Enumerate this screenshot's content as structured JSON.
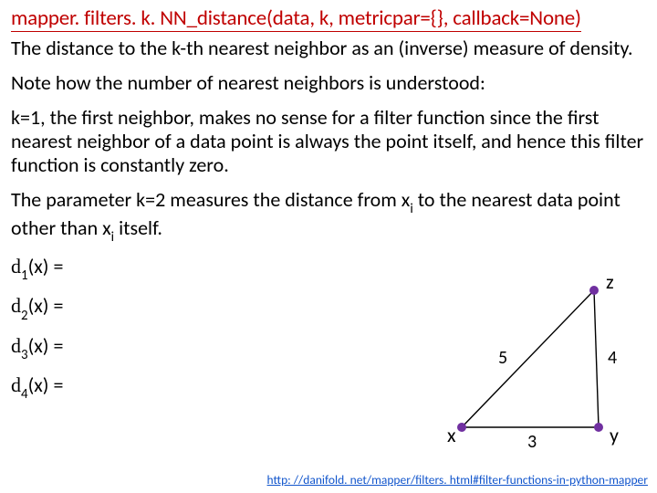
{
  "signature": "mapper. filters. k. NN_distance(data, k, metricpar={}, callback=None)",
  "p1": "The distance to the k-th nearest neighbor as an (inverse) measure of density.",
  "p2": "Note how the number of nearest neighbors is understood:",
  "p3": "k=1, the first neighbor, makes no sense for a filter function since the first nearest neighbor of a data point is always the point itself, and hence this filter function is constantly zero.",
  "p4_a": "The parameter k=2 measures the distance from x",
  "p4_b": " to the nearest data point other than x",
  "p4_c": " itself.",
  "p4_sub": "i",
  "delta_char": "d",
  "delta_tail": "(x) =",
  "delta_subs": {
    "d1": "1",
    "d2": "2",
    "d3": "3",
    "d4": "4"
  },
  "diagram": {
    "vertices": {
      "z": "z",
      "x": "x",
      "y": "y"
    },
    "edges": {
      "e_xz": "5",
      "e_zy": "4",
      "e_xy": "3"
    }
  },
  "url": "http: //danifold. net/mapper/filters. html#filter-functions-in-python-mapper"
}
